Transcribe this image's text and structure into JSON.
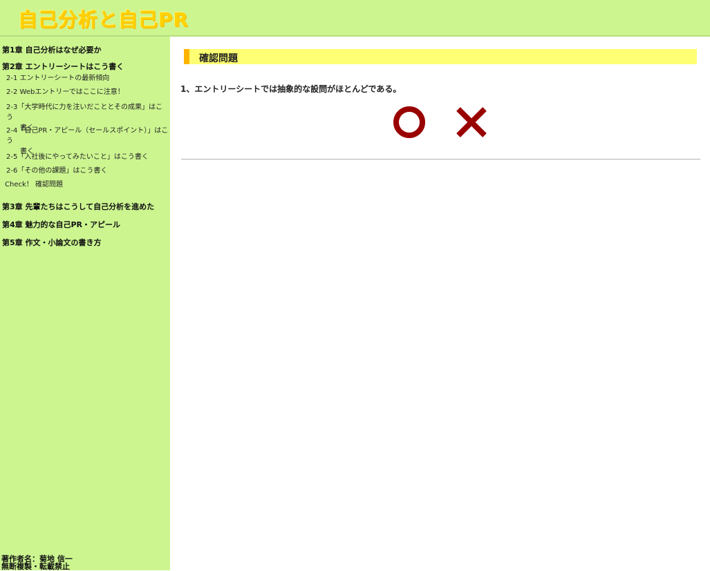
{
  "header": {
    "title": "自己分析と自己PR"
  },
  "sidebar": {
    "chapters": [
      {
        "label": "第1章 自己分析はなぜ必要か"
      },
      {
        "label": "第2章 エントリーシートはこう書く",
        "items": [
          {
            "label": "2-1 エントリーシートの最新傾向"
          },
          {
            "label": "2-2 Webエントリーではここに注意！"
          },
          {
            "label": "2-3「大学時代に力を注いだこととその成果」はこう",
            "label2": "書く"
          },
          {
            "label": "2-4「自己PR・アピール（セールスポイント）」はこう",
            "label2": "書く"
          },
          {
            "label": "2-5「入社後にやってみたいこと」はこう書く"
          },
          {
            "label": "2-6「その他の課題」はこう書く"
          },
          {
            "label": "Check！ 確認問題"
          }
        ]
      },
      {
        "label": "第3章 先輩たちはこうして自己分析を進めた"
      },
      {
        "label": "第4章 魅力的な自己PR・アピール"
      },
      {
        "label": "第5章 作文・小論文の書き方"
      }
    ],
    "footer": {
      "line1": "著作者名：菊地 信一",
      "line2": "無断複製・転載禁止"
    }
  },
  "main": {
    "heading": "確認問題",
    "question": "1、エントリーシートでは抽象的な設問がほとんどである。",
    "answers": [
      {
        "symbol": "circle",
        "icon": "circle-mark-icon"
      },
      {
        "symbol": "cross",
        "icon": "cross-mark-icon"
      }
    ],
    "answer_color": "#990000"
  },
  "colors": {
    "sidebar_bg": "#ccf590",
    "heading_bg": "#ffff73",
    "heading_accent": "#ffb400",
    "title_color": "#ffd200"
  }
}
